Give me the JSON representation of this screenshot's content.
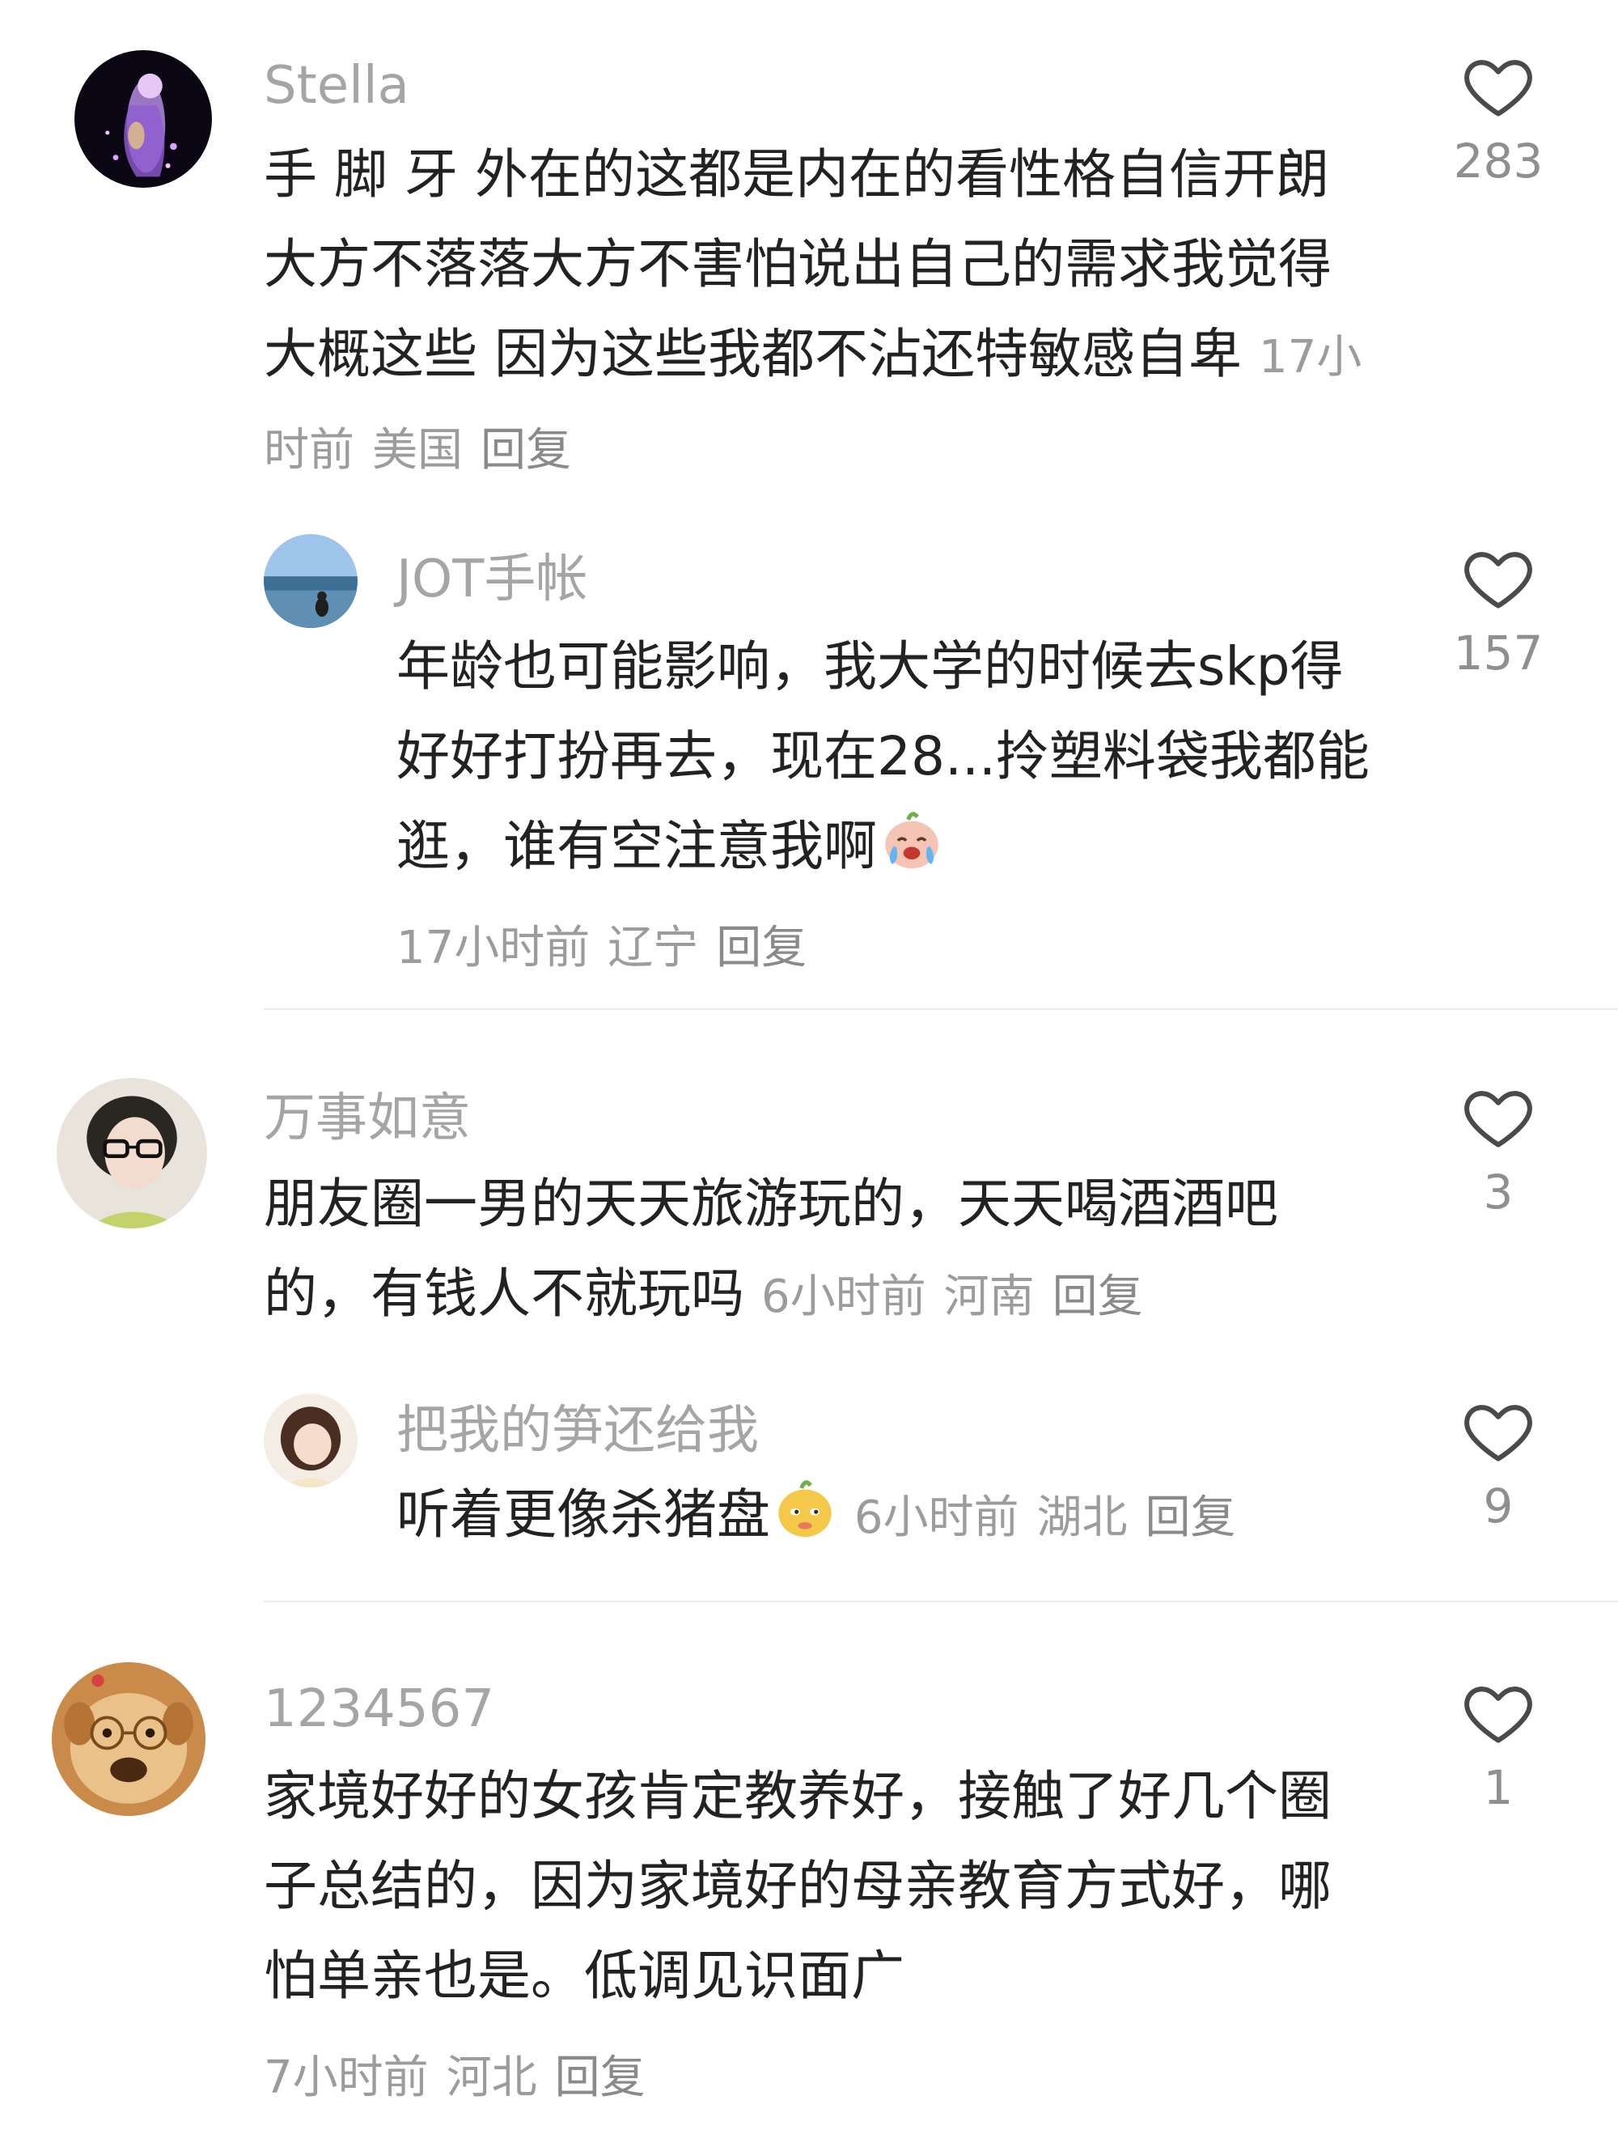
{
  "comments": [
    {
      "username": "Stella",
      "text": "手 脚 牙 外在的这都是内在的看性格自信开朗大方不落落大方不害怕说出自己的需求我觉得大概这些 因为这些我都不沾还特敏感自卑",
      "time": "17小时前",
      "location": "美国",
      "reply_label": "回复",
      "likes": "283",
      "avatar_icon": "fantasy-figure-avatar"
    },
    {
      "username": "JOT手帐",
      "text": "年龄也可能影响，我大学的时候去skp得好好打扮再去，现在28...拎塑料袋我都能逛，谁有空注意我啊",
      "emoji": "crying-laughing-emoji",
      "time": "17小时前",
      "location": "辽宁",
      "reply_label": "回复",
      "likes": "157",
      "avatar_icon": "seaside-avatar"
    },
    {
      "username": "万事如意",
      "text": "朋友圈一男的天天旅游玩的，天天喝酒酒吧的，有钱人不就玩吗",
      "time": "6小时前",
      "location": "河南",
      "reply_label": "回复",
      "likes": "3",
      "avatar_icon": "glasses-woman-avatar"
    },
    {
      "username": "把我的笋还给我",
      "text": "听着更像杀猪盘",
      "emoji": "smirk-emoji",
      "time": "6小时前",
      "location": "湖北",
      "reply_label": "回复",
      "likes": "9",
      "avatar_icon": "girl-avatar"
    },
    {
      "username": "1234567",
      "text": "家境好好的女孩肯定教养好，接触了好几个圈子总结的，因为家境好的母亲教育方式好，哪怕单亲也是。低调见识面广",
      "time": "7小时前",
      "location": "河北",
      "reply_label": "回复",
      "likes": "1",
      "avatar_icon": "dog-with-glasses-avatar"
    }
  ],
  "colors": {
    "username": "#a5a5a5",
    "text": "#222222",
    "meta": "#9c9c9c",
    "divider": "#ececec"
  }
}
